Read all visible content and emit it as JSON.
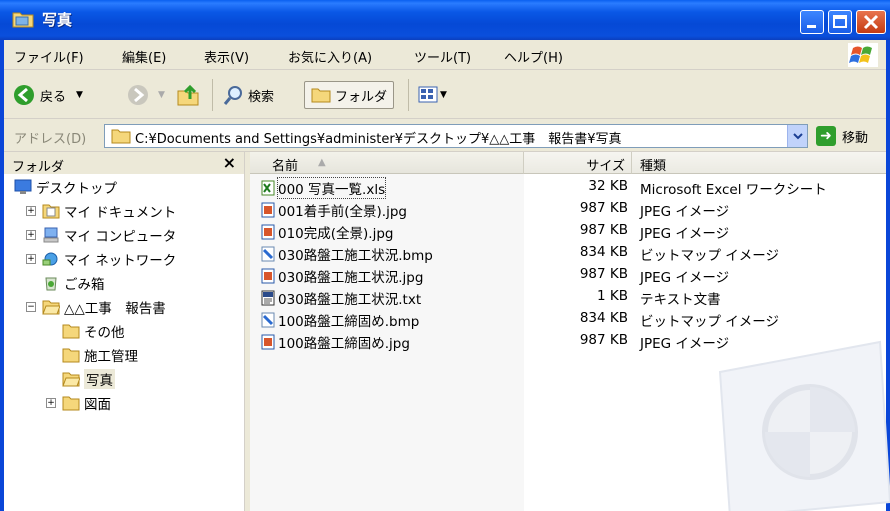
{
  "window": {
    "title": "写真"
  },
  "menu": [
    "ファイル(F)",
    "編集(E)",
    "表示(V)",
    "お気に入り(A)",
    "ツール(T)",
    "ヘルプ(H)"
  ],
  "toolbar": {
    "back_label": "戻る",
    "search_label": "検索",
    "folders_label": "フォルダ"
  },
  "address": {
    "label": "アドレス(D)",
    "path": "C:¥Documents and Settings¥administer¥デスクトップ¥△△工事　報告書¥写真",
    "go_label": "移動"
  },
  "folders_pane": {
    "title": "フォルダ",
    "close": "×",
    "tree": [
      {
        "label": "デスクトップ",
        "icon": "desktop-icon",
        "expander": ""
      },
      {
        "label": "マイ ドキュメント",
        "icon": "my-documents-icon",
        "expander": "+"
      },
      {
        "label": "マイ コンピュータ",
        "icon": "my-computer-icon",
        "expander": "+"
      },
      {
        "label": "マイ ネットワーク",
        "icon": "my-network-icon",
        "expander": "+"
      },
      {
        "label": "ごみ箱",
        "icon": "recycle-bin-icon",
        "expander": ""
      },
      {
        "label": "△△工事　報告書",
        "icon": "folder-open-icon",
        "expander": "−"
      },
      {
        "label": "その他",
        "icon": "folder-icon",
        "expander": ""
      },
      {
        "label": "施工管理",
        "icon": "folder-icon",
        "expander": ""
      },
      {
        "label": "写真",
        "icon": "folder-open-icon",
        "expander": ""
      },
      {
        "label": "図面",
        "icon": "folder-icon",
        "expander": "+"
      }
    ]
  },
  "file_list": {
    "columns": {
      "name": "名前",
      "size": "サイズ",
      "type": "種類"
    },
    "sort_indicator": "▲",
    "files": [
      {
        "name": "000 写真一覧.xls",
        "size": "32 KB",
        "type": "Microsoft Excel ワークシート",
        "icon": "excel-file-icon"
      },
      {
        "name": "001着手前(全景).jpg",
        "size": "987 KB",
        "type": "JPEG イメージ",
        "icon": "jpeg-file-icon"
      },
      {
        "name": "010完成(全景).jpg",
        "size": "987 KB",
        "type": "JPEG イメージ",
        "icon": "jpeg-file-icon"
      },
      {
        "name": "030路盤工施工状況.bmp",
        "size": "834 KB",
        "type": "ビットマップ イメージ",
        "icon": "bitmap-file-icon"
      },
      {
        "name": "030路盤工施工状況.jpg",
        "size": "987 KB",
        "type": "JPEG イメージ",
        "icon": "jpeg-file-icon"
      },
      {
        "name": "030路盤工施工状況.txt",
        "size": "1 KB",
        "type": "テキスト文書",
        "icon": "text-file-icon"
      },
      {
        "name": "100路盤工締固め.bmp",
        "size": "834 KB",
        "type": "ビットマップ イメージ",
        "icon": "bitmap-file-icon"
      },
      {
        "name": "100路盤工締固め.jpg",
        "size": "987 KB",
        "type": "JPEG イメージ",
        "icon": "jpeg-file-icon"
      }
    ]
  }
}
